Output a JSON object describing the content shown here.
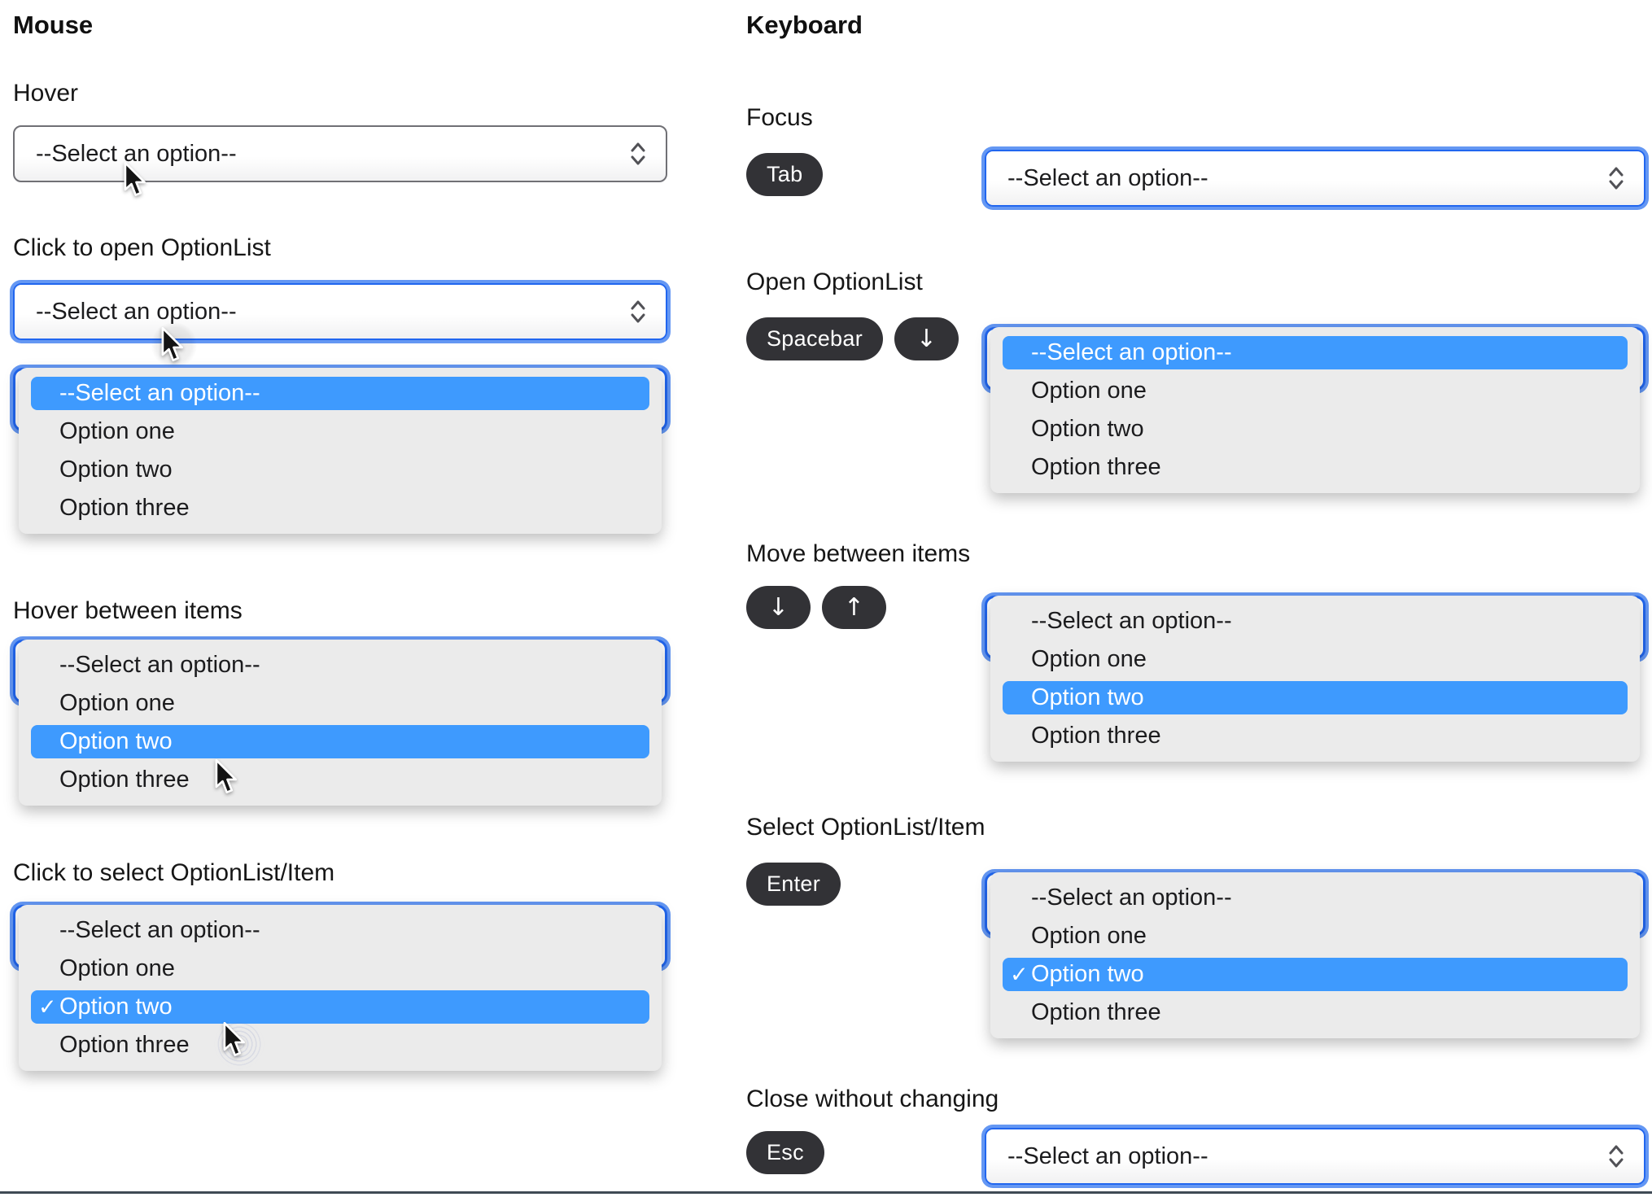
{
  "page": {
    "divider_color": "#3F4A54"
  },
  "colors": {
    "highlight_blue": "#3E9AFE",
    "focus_border_blue": "#2166EF",
    "focus_ring_blue": "#6497F3",
    "panel_gray": "#EBEBEB",
    "select_border_gray": "#707075",
    "key_badge_bg": "#323236"
  },
  "select": {
    "placeholder": "--Select an option--",
    "options": [
      "Option one",
      "Option two",
      "Option three"
    ],
    "check": "✓"
  },
  "mouse": {
    "title": "Mouse",
    "sections": [
      {
        "label": "Hover"
      },
      {
        "label": "Click to open OptionList"
      },
      {
        "label": "Hover between items"
      },
      {
        "label": "Click to select OptionList/Item"
      }
    ]
  },
  "keyboard": {
    "title": "Keyboard",
    "sections": [
      {
        "label": "Focus",
        "keys": [
          "Tab"
        ]
      },
      {
        "label": "Open OptionList",
        "keys": [
          "Spacebar",
          "↓"
        ]
      },
      {
        "label": "Move between items",
        "keys": [
          "↓",
          "↑"
        ]
      },
      {
        "label": "Select OptionList/Item",
        "keys": [
          "Enter"
        ]
      },
      {
        "label": "Close without changing",
        "keys": [
          "Esc"
        ]
      }
    ]
  }
}
